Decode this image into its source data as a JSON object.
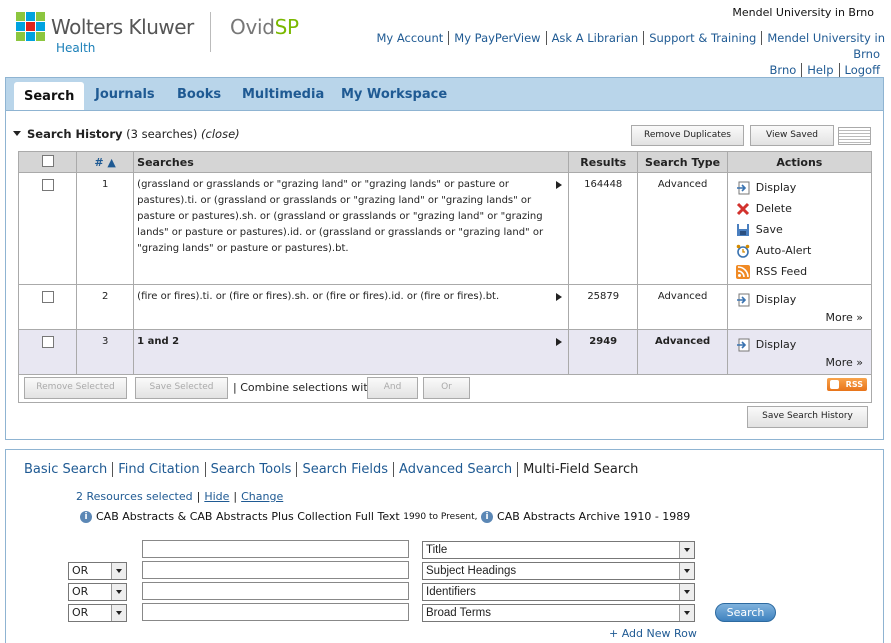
{
  "header": {
    "brand": "Wolters Kluwer",
    "brand_sub": "Health",
    "product_a": "Ovid",
    "product_b": "SP",
    "institution": "Mendel University in Brno",
    "links": [
      "My Account",
      "My PayPerView",
      "Ask A Librarian",
      "Support & Training",
      "Mendel University in Brno",
      "Help",
      "Logoff"
    ]
  },
  "tabs": [
    "Search",
    "Journals",
    "Books",
    "Multimedia",
    "My Workspace"
  ],
  "history": {
    "title": "Search History",
    "count": "(3 searches)",
    "close": "(close)",
    "remove_duplicates": "Remove Duplicates",
    "view_saved": "View Saved",
    "columns": {
      "num": "# ▲",
      "searches": "Searches",
      "results": "Results",
      "type": "Search Type",
      "actions": "Actions"
    },
    "rows": [
      {
        "num": "1",
        "query": "(grassland or grasslands or \"grazing land\" or \"grazing lands\" or pasture or pastures).ti. or (grassland or grasslands or \"grazing land\" or \"grazing lands\" or pasture or pastures).sh. or (grassland or grasslands or \"grazing land\" or \"grazing lands\" or pasture or pastures).id. or (grassland or grasslands or \"grazing land\" or \"grazing lands\" or pasture or pastures).bt.",
        "results": "164448",
        "type": "Advanced"
      },
      {
        "num": "2",
        "query": "(fire or fires).ti. or (fire or fires).sh. or (fire or fires).id. or (fire or fires).bt.",
        "results": "25879",
        "type": "Advanced"
      },
      {
        "num": "3",
        "query": "1 and 2",
        "results": "2949",
        "type": "Advanced"
      }
    ],
    "actions": {
      "display": "Display",
      "delete": "Delete",
      "save": "Save",
      "auto_alert": "Auto-Alert",
      "rss_feed": "RSS Feed",
      "more": "More »"
    },
    "remove_selected": "Remove Selected",
    "save_selected": "Save Selected",
    "combine_label": "| Combine selections with:",
    "and": "And",
    "or": "Or",
    "rss": "RSS",
    "save_history": "Save Search History"
  },
  "search": {
    "types": [
      "Basic Search",
      "Find Citation",
      "Search Tools",
      "Search Fields",
      "Advanced Search",
      "Multi-Field Search"
    ],
    "resources_selected": "2 Resources selected",
    "hide": "Hide",
    "change": "Change",
    "db1": "CAB Abstracts & CAB Abstracts Plus Collection Full Text",
    "db1_range": "1990 to Present,",
    "db2": "CAB Abstracts Archive 1910 - 1989",
    "rows": [
      {
        "op": "",
        "field": "Title"
      },
      {
        "op": "OR",
        "field": "Subject Headings"
      },
      {
        "op": "OR",
        "field": "Identifiers"
      },
      {
        "op": "OR",
        "field": "Broad Terms"
      }
    ],
    "search_button": "Search",
    "add_row": "+ Add New Row"
  }
}
